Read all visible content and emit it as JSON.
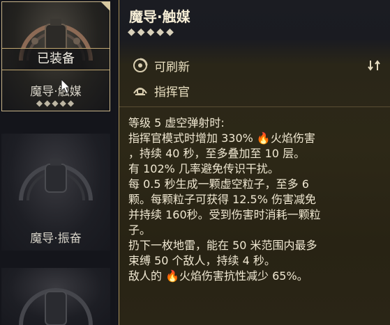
{
  "inventory": {
    "selected": {
      "equipped_label": "已装备",
      "name": "魔导·触媒",
      "rank": "◆◆◆◆◆"
    },
    "items": [
      {
        "name": "魔导·振奋"
      },
      {
        "name": ""
      }
    ]
  },
  "detail": {
    "title": "魔导·触媒",
    "rank": "◆◆◆◆◆",
    "properties": [
      {
        "label": "可刷新",
        "icon": "refresh-icon"
      },
      {
        "label": "指挥官",
        "icon": "commander-icon"
      }
    ],
    "description": {
      "line1": "等级 5  虚空弹射时:",
      "line2a": "指挥官模式时增加 330% ",
      "line2b": "火焰伤害",
      "line3": "，持续 40 秒，至多叠加至 10 层。",
      "line4": "有 102% 几率避免传识干扰。",
      "line5": "每 0.5 秒生成一颗虚空粒子，至多 6",
      "line6": "颗。每颗粒子可获得 12.5% 伤害减免",
      "line7": "并持续 160秒。受到伤害时消耗一颗粒",
      "line8": "子。",
      "line9": "扔下一枚地雷，能在 50 米范围内最多",
      "line10": "束缚 50 个敌人，持续 4 秒。",
      "line11a": "敌人的 ",
      "line11b": "火焰伤害抗性减少 65%。"
    }
  },
  "colors": {
    "fire": "#ff7a1a",
    "accent": "#c9b58a"
  }
}
